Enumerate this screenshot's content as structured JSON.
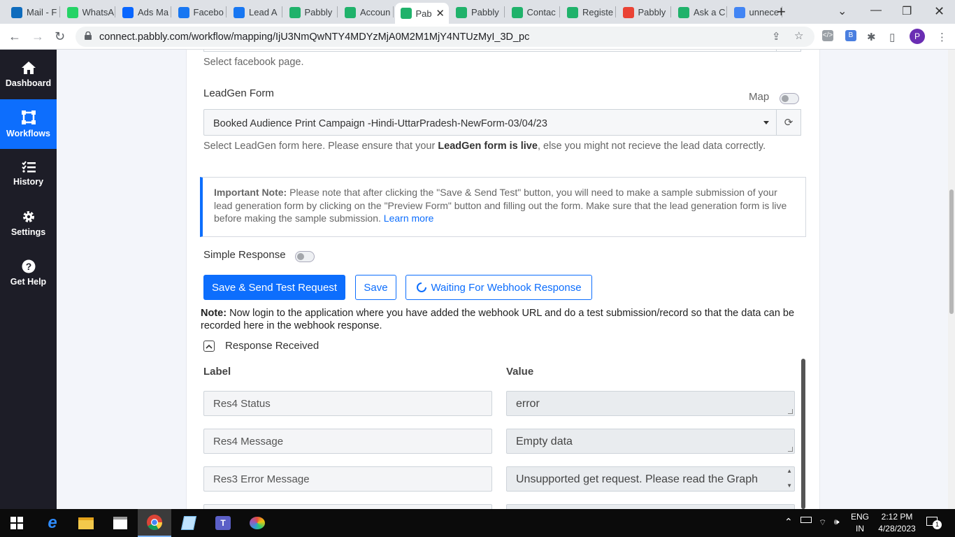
{
  "browser": {
    "tabs": [
      {
        "title": "Mail - F",
        "icon": "outlook-icon",
        "color": "#0f6cbd"
      },
      {
        "title": "WhatsA",
        "icon": "whatsapp-icon",
        "color": "#25d366"
      },
      {
        "title": "Ads Ma",
        "icon": "meta-icon",
        "color": "#0866ff"
      },
      {
        "title": "Facebo",
        "icon": "facebook-icon",
        "color": "#1877f2"
      },
      {
        "title": "Lead A",
        "icon": "facebook-icon",
        "color": "#1877f2"
      },
      {
        "title": "Pabbly",
        "icon": "pabbly-icon",
        "color": "#20b26b"
      },
      {
        "title": "Accoun",
        "icon": "pabbly-icon",
        "color": "#20b26b"
      },
      {
        "title": "Pab",
        "icon": "pabbly-icon",
        "color": "#20b26b",
        "active": true
      },
      {
        "title": "Pabbly",
        "icon": "pabbly-icon",
        "color": "#20b26b"
      },
      {
        "title": "Contac",
        "icon": "pabbly-icon",
        "color": "#20b26b"
      },
      {
        "title": "Registe",
        "icon": "pabbly-icon",
        "color": "#20b26b"
      },
      {
        "title": "Pabbly",
        "icon": "gmail-icon",
        "color": "#ea4335"
      },
      {
        "title": "Ask a C",
        "icon": "pabbly-icon",
        "color": "#20b26b"
      },
      {
        "title": "unnece",
        "icon": "google-icon",
        "color": "#4285f4"
      }
    ],
    "url": "connect.pabbly.com/workflow/mapping/IjU3NmQwNTY4MDYzMjA0M2M1MjY4NTUzMyI_3D_pc",
    "profile_initial": "P"
  },
  "sidebar": {
    "items": [
      {
        "label": "Dashboard",
        "icon": "home-icon"
      },
      {
        "label": "Workflows",
        "icon": "workflows-icon",
        "active": true
      },
      {
        "label": "History",
        "icon": "history-list-icon"
      },
      {
        "label": "Settings",
        "icon": "gear-icon"
      },
      {
        "label": "Get Help",
        "icon": "help-icon"
      }
    ]
  },
  "form": {
    "page_hint": "Select facebook page.",
    "leadgen_label": "LeadGen Form",
    "map_label": "Map",
    "leadgen_value": "Booked Audience Print Campaign -Hindi-UttarPradesh-NewForm-03/04/23",
    "leadgen_hint_pre": "Select LeadGen form here. Please ensure that your ",
    "leadgen_hint_bold": "LeadGen form is live",
    "leadgen_hint_post": ", else you might not recieve the lead data correctly."
  },
  "important_note": {
    "title": "Important Note:",
    "text": " Please note that after clicking the \"Save & Send Test\" button, you will need to make a sample submission of your lead generation form by clicking on the \"Preview Form\" button and filling out the form. Make sure that the lead generation form is live before making the sample submission. ",
    "link": "Learn more"
  },
  "simple_response_label": "Simple Response",
  "buttons": {
    "save_send": "Save & Send Test Request",
    "save": "Save",
    "waiting": "Waiting For Webhook Response"
  },
  "note": {
    "title": "Note:",
    "text": " Now login to the application where you have added the webhook URL and do a test submission/record so that the data can be recorded here in the webhook response."
  },
  "response": {
    "title": "Response Received",
    "label_header": "Label",
    "value_header": "Value",
    "rows": [
      {
        "label": "Res4 Status",
        "value": "error"
      },
      {
        "label": "Res4 Message",
        "value": "Empty data"
      },
      {
        "label": "Res3 Error Message",
        "value": "Unsupported get request. Please read the Graph"
      }
    ]
  },
  "taskbar": {
    "lang_top": "ENG",
    "lang_bottom": "IN",
    "time": "2:12 PM",
    "date": "4/28/2023",
    "notification_count": "1"
  }
}
